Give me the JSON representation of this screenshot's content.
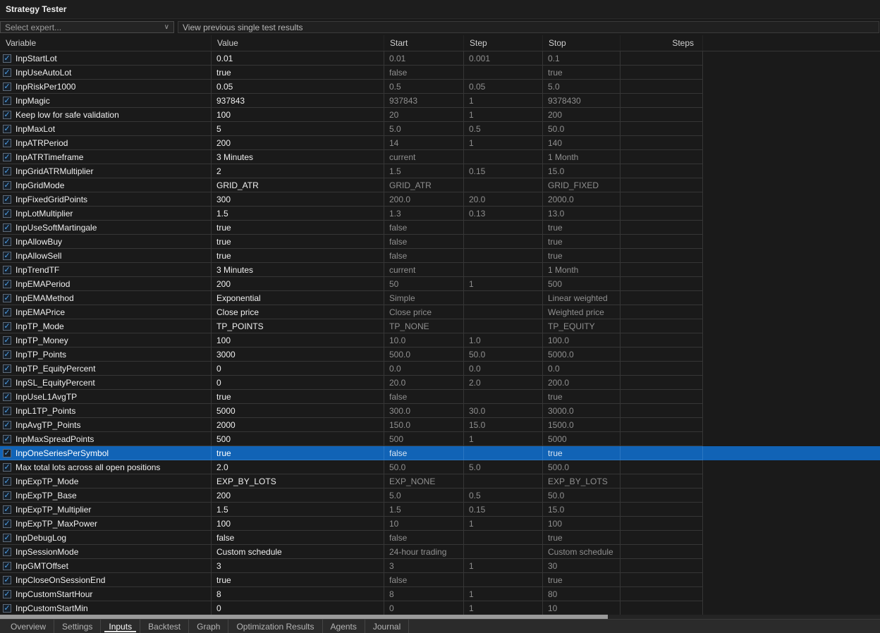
{
  "titlebar": {
    "title": "Strategy Tester"
  },
  "toolbar": {
    "expert_select_label": "Select expert...",
    "view_results_label": "View previous single test results"
  },
  "icons": {
    "check": "✓",
    "chevron_down": "∨"
  },
  "colors": {
    "selection": "#1163b6",
    "check": "#4f9fe6"
  },
  "table": {
    "columns": [
      "Variable",
      "Value",
      "Start",
      "Step",
      "Stop",
      "Steps"
    ],
    "rows": [
      {
        "variable": "InpStartLot",
        "value": "0.01",
        "start": "0.01",
        "step": "0.001",
        "stop": "0.1",
        "steps": "",
        "checked": true
      },
      {
        "variable": "InpUseAutoLot",
        "value": "true",
        "start": "false",
        "step": "",
        "stop": "true",
        "steps": "",
        "checked": true
      },
      {
        "variable": "InpRiskPer1000",
        "value": "0.05",
        "start": "0.5",
        "step": "0.05",
        "stop": "5.0",
        "steps": "",
        "checked": true
      },
      {
        "variable": "InpMagic",
        "value": "937843",
        "start": "937843",
        "step": "1",
        "stop": "9378430",
        "steps": "",
        "checked": true
      },
      {
        "variable": "Keep low for safe validation",
        "value": "100",
        "start": "20",
        "step": "1",
        "stop": "200",
        "steps": "",
        "checked": true
      },
      {
        "variable": "InpMaxLot",
        "value": "5",
        "start": "5.0",
        "step": "0.5",
        "stop": "50.0",
        "steps": "",
        "checked": true
      },
      {
        "variable": "InpATRPeriod",
        "value": "200",
        "start": "14",
        "step": "1",
        "stop": "140",
        "steps": "",
        "checked": true
      },
      {
        "variable": "InpATRTimeframe",
        "value": "3 Minutes",
        "start": "current",
        "step": "",
        "stop": "1 Month",
        "steps": "",
        "checked": true
      },
      {
        "variable": "InpGridATRMultiplier",
        "value": "2",
        "start": "1.5",
        "step": "0.15",
        "stop": "15.0",
        "steps": "",
        "checked": true
      },
      {
        "variable": "InpGridMode",
        "value": "GRID_ATR",
        "start": "GRID_ATR",
        "step": "",
        "stop": "GRID_FIXED",
        "steps": "",
        "checked": true
      },
      {
        "variable": "InpFixedGridPoints",
        "value": "300",
        "start": "200.0",
        "step": "20.0",
        "stop": "2000.0",
        "steps": "",
        "checked": true
      },
      {
        "variable": "InpLotMultiplier",
        "value": "1.5",
        "start": "1.3",
        "step": "0.13",
        "stop": "13.0",
        "steps": "",
        "checked": true
      },
      {
        "variable": "InpUseSoftMartingale",
        "value": "true",
        "start": "false",
        "step": "",
        "stop": "true",
        "steps": "",
        "checked": true
      },
      {
        "variable": "InpAllowBuy",
        "value": "true",
        "start": "false",
        "step": "",
        "stop": "true",
        "steps": "",
        "checked": true
      },
      {
        "variable": "InpAllowSell",
        "value": "true",
        "start": "false",
        "step": "",
        "stop": "true",
        "steps": "",
        "checked": true
      },
      {
        "variable": "InpTrendTF",
        "value": "3 Minutes",
        "start": "current",
        "step": "",
        "stop": "1 Month",
        "steps": "",
        "checked": true
      },
      {
        "variable": "InpEMAPeriod",
        "value": "200",
        "start": "50",
        "step": "1",
        "stop": "500",
        "steps": "",
        "checked": true
      },
      {
        "variable": "InpEMAMethod",
        "value": "Exponential",
        "start": "Simple",
        "step": "",
        "stop": "Linear weighted",
        "steps": "",
        "checked": true
      },
      {
        "variable": "InpEMAPrice",
        "value": "Close price",
        "start": "Close price",
        "step": "",
        "stop": "Weighted price",
        "steps": "",
        "checked": true
      },
      {
        "variable": "InpTP_Mode",
        "value": "TP_POINTS",
        "start": "TP_NONE",
        "step": "",
        "stop": "TP_EQUITY",
        "steps": "",
        "checked": true
      },
      {
        "variable": "InpTP_Money",
        "value": "100",
        "start": "10.0",
        "step": "1.0",
        "stop": "100.0",
        "steps": "",
        "checked": true
      },
      {
        "variable": "InpTP_Points",
        "value": "3000",
        "start": "500.0",
        "step": "50.0",
        "stop": "5000.0",
        "steps": "",
        "checked": true
      },
      {
        "variable": "InpTP_EquityPercent",
        "value": "0",
        "start": "0.0",
        "step": "0.0",
        "stop": "0.0",
        "steps": "",
        "checked": true
      },
      {
        "variable": "InpSL_EquityPercent",
        "value": "0",
        "start": "20.0",
        "step": "2.0",
        "stop": "200.0",
        "steps": "",
        "checked": true
      },
      {
        "variable": "InpUseL1AvgTP",
        "value": "true",
        "start": "false",
        "step": "",
        "stop": "true",
        "steps": "",
        "checked": true
      },
      {
        "variable": "InpL1TP_Points",
        "value": "5000",
        "start": "300.0",
        "step": "30.0",
        "stop": "3000.0",
        "steps": "",
        "checked": true
      },
      {
        "variable": "InpAvgTP_Points",
        "value": "2000",
        "start": "150.0",
        "step": "15.0",
        "stop": "1500.0",
        "steps": "",
        "checked": true
      },
      {
        "variable": "InpMaxSpreadPoints",
        "value": "500",
        "start": "500",
        "step": "1",
        "stop": "5000",
        "steps": "",
        "checked": true
      },
      {
        "variable": "InpOneSeriesPerSymbol",
        "value": "true",
        "start": "false",
        "step": "",
        "stop": "true",
        "steps": "",
        "checked": true,
        "selected": true
      },
      {
        "variable": "Max total lots across all open positions",
        "value": "2.0",
        "start": "50.0",
        "step": "5.0",
        "stop": "500.0",
        "steps": "",
        "checked": true
      },
      {
        "variable": "InpExpTP_Mode",
        "value": "EXP_BY_LOTS",
        "start": "EXP_NONE",
        "step": "",
        "stop": "EXP_BY_LOTS",
        "steps": "",
        "checked": true
      },
      {
        "variable": "InpExpTP_Base",
        "value": "200",
        "start": "5.0",
        "step": "0.5",
        "stop": "50.0",
        "steps": "",
        "checked": true
      },
      {
        "variable": "InpExpTP_Multiplier",
        "value": "1.5",
        "start": "1.5",
        "step": "0.15",
        "stop": "15.0",
        "steps": "",
        "checked": true
      },
      {
        "variable": "InpExpTP_MaxPower",
        "value": "100",
        "start": "10",
        "step": "1",
        "stop": "100",
        "steps": "",
        "checked": true
      },
      {
        "variable": "InpDebugLog",
        "value": "false",
        "start": "false",
        "step": "",
        "stop": "true",
        "steps": "",
        "checked": true
      },
      {
        "variable": "InpSessionMode",
        "value": "Custom schedule",
        "start": "24-hour trading",
        "step": "",
        "stop": "Custom schedule",
        "steps": "",
        "checked": true
      },
      {
        "variable": "InpGMTOffset",
        "value": "3",
        "start": "3",
        "step": "1",
        "stop": "30",
        "steps": "",
        "checked": true
      },
      {
        "variable": "InpCloseOnSessionEnd",
        "value": "true",
        "start": "false",
        "step": "",
        "stop": "true",
        "steps": "",
        "checked": true
      },
      {
        "variable": "InpCustomStartHour",
        "value": "8",
        "start": "8",
        "step": "1",
        "stop": "80",
        "steps": "",
        "checked": true
      },
      {
        "variable": "InpCustomStartMin",
        "value": "0",
        "start": "0",
        "step": "1",
        "stop": "10",
        "steps": "",
        "checked": true
      }
    ]
  },
  "tabs": {
    "items": [
      "Overview",
      "Settings",
      "Inputs",
      "Backtest",
      "Graph",
      "Optimization Results",
      "Agents",
      "Journal"
    ],
    "active": "Inputs",
    "active_index": 2
  }
}
